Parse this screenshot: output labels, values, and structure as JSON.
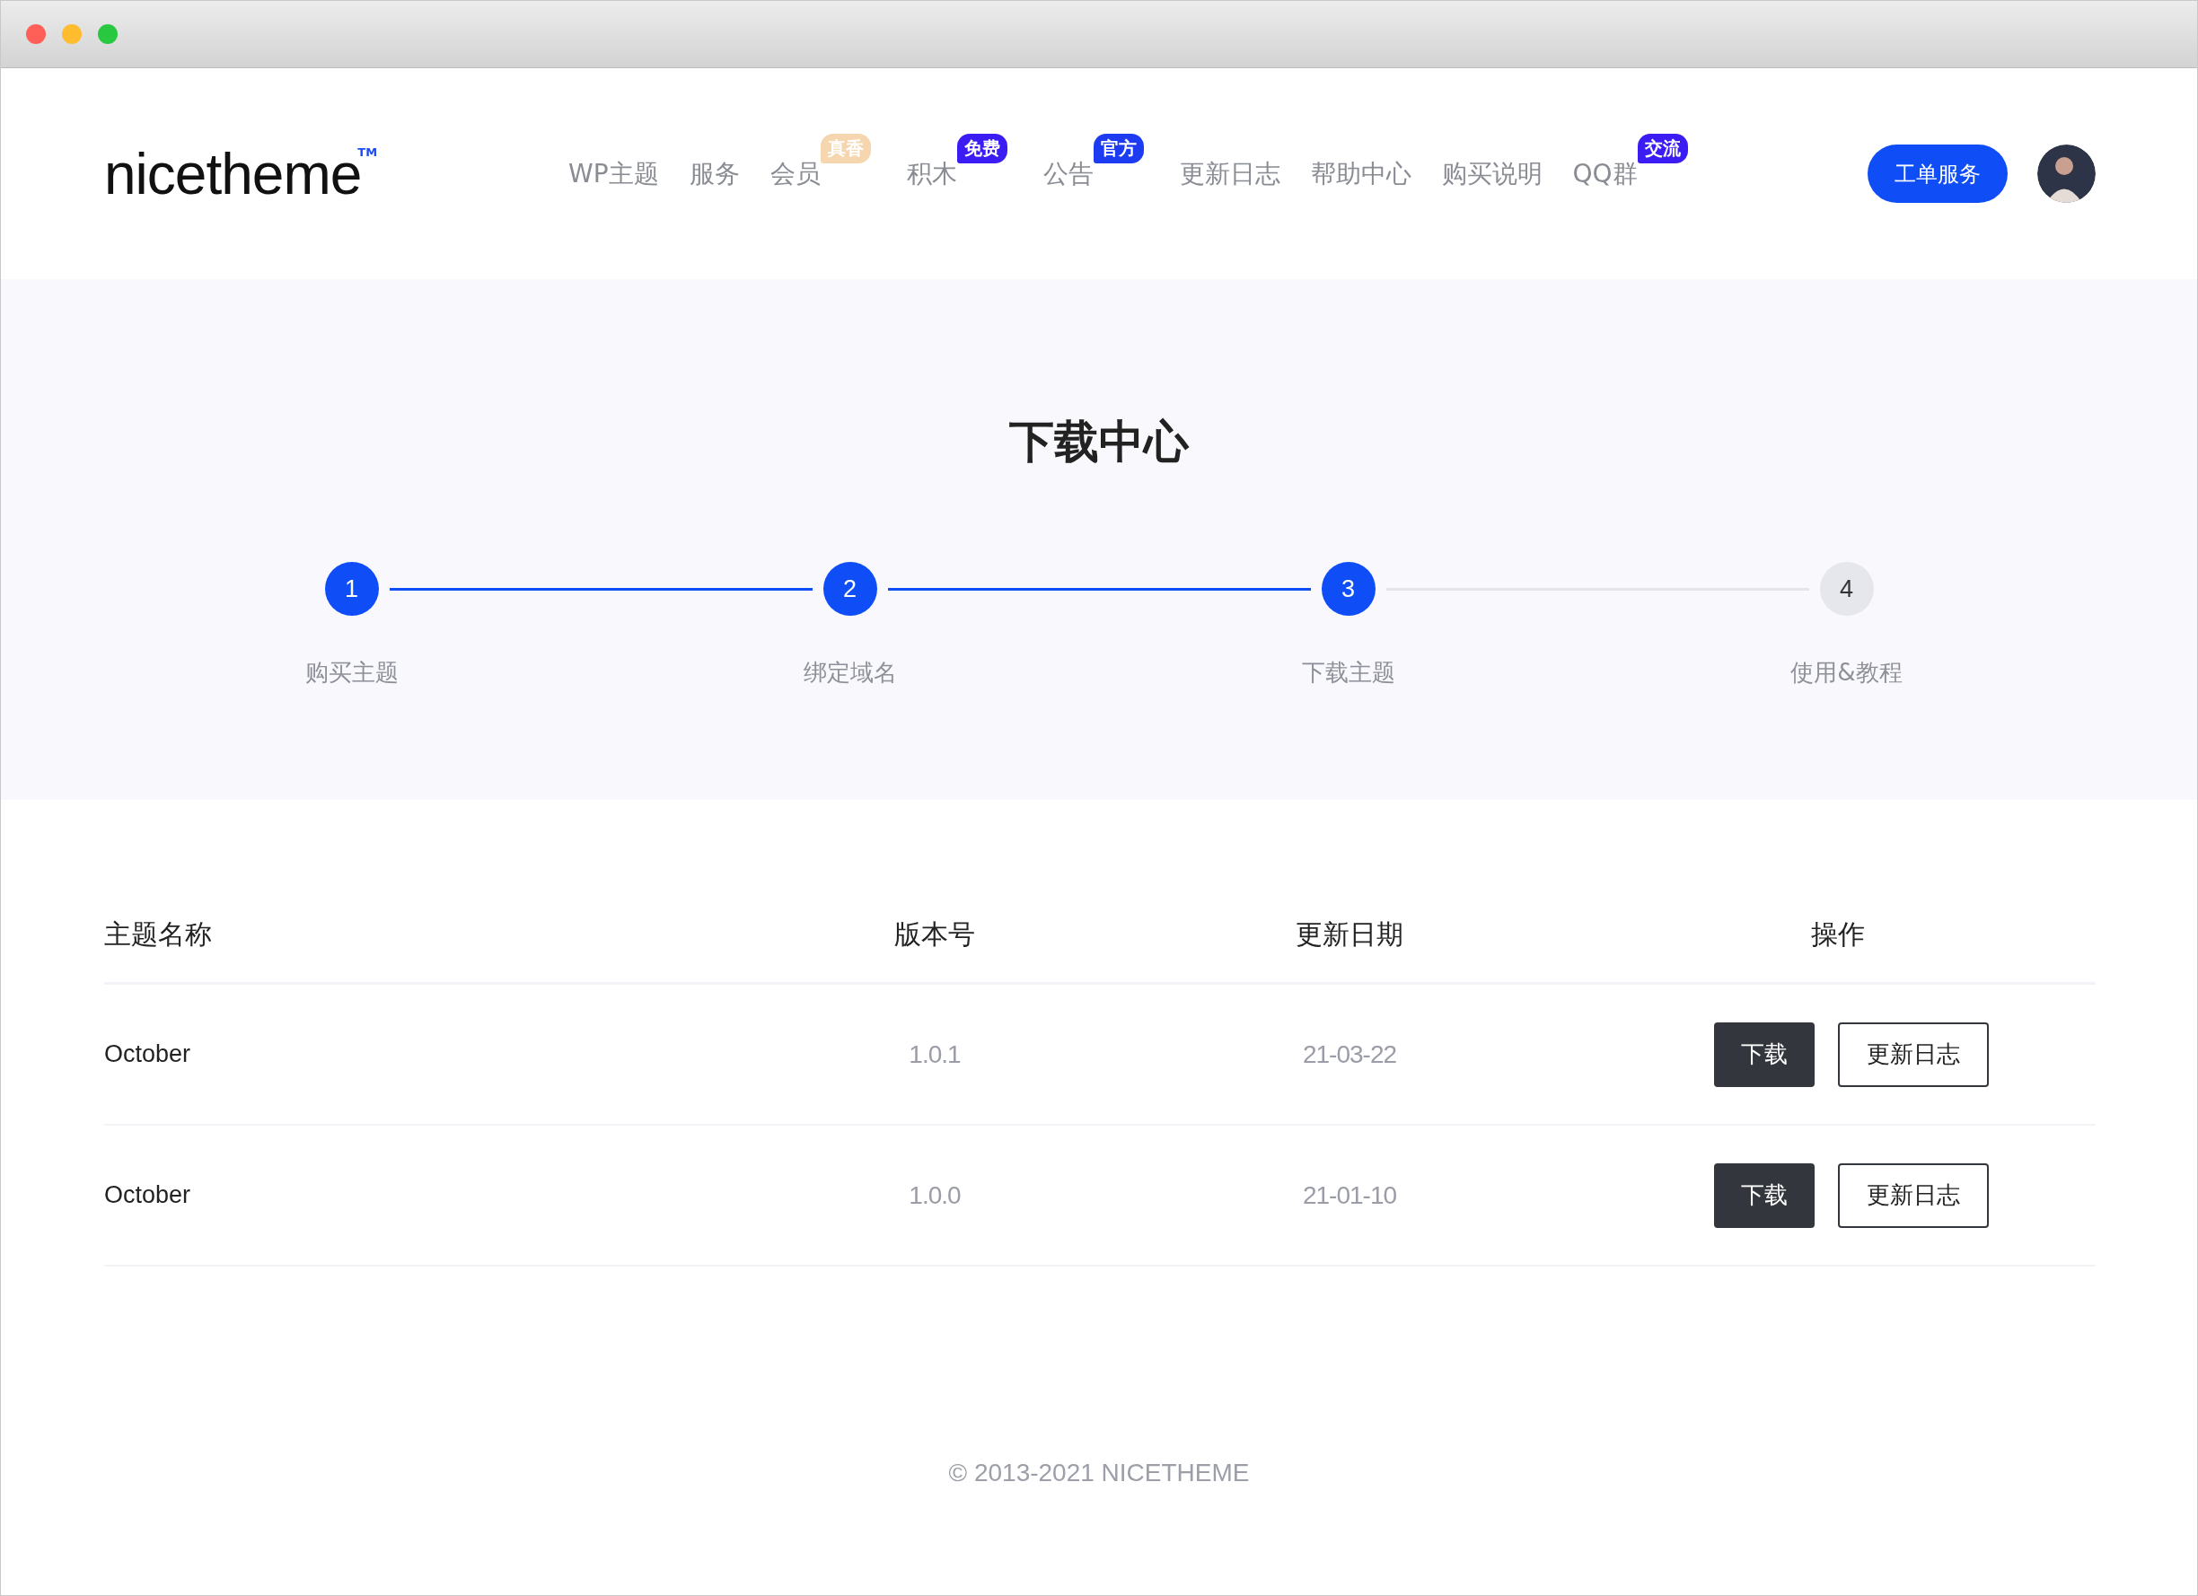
{
  "logo": {
    "text": "nicetheme",
    "mark": "TM"
  },
  "nav": [
    {
      "label": "WP主题"
    },
    {
      "label": "服务"
    },
    {
      "label": "会员",
      "badge": {
        "text": "真香",
        "color": "#f5d6ae"
      }
    },
    {
      "label": "积木",
      "badge": {
        "text": "免费",
        "color": "#3b1cf2"
      }
    },
    {
      "label": "公告",
      "badge": {
        "text": "官方",
        "color": "#1d3cf2"
      }
    },
    {
      "label": "更新日志"
    },
    {
      "label": "帮助中心"
    },
    {
      "label": "购买说明"
    },
    {
      "label": "QQ群",
      "badge": {
        "text": "交流",
        "color": "#3b1cf2"
      }
    }
  ],
  "ticket_button": "工单服务",
  "hero": {
    "title": "下载中心",
    "steps": [
      {
        "number": "1",
        "label": "购买主题",
        "completed": true
      },
      {
        "number": "2",
        "label": "绑定域名",
        "completed": true
      },
      {
        "number": "3",
        "label": "下载主题",
        "completed": true
      },
      {
        "number": "4",
        "label": "使用&教程",
        "completed": false
      }
    ]
  },
  "table": {
    "columns": [
      "主题名称",
      "版本号",
      "更新日期",
      "操作"
    ],
    "rows": [
      {
        "name": "October",
        "version": "1.0.1",
        "date": "21-03-22",
        "actions": [
          "下载",
          "更新日志"
        ]
      },
      {
        "name": "October",
        "version": "1.0.0",
        "date": "21-01-10",
        "actions": [
          "下载",
          "更新日志"
        ]
      }
    ]
  },
  "footer": "© 2013-2021 NICETHEME"
}
